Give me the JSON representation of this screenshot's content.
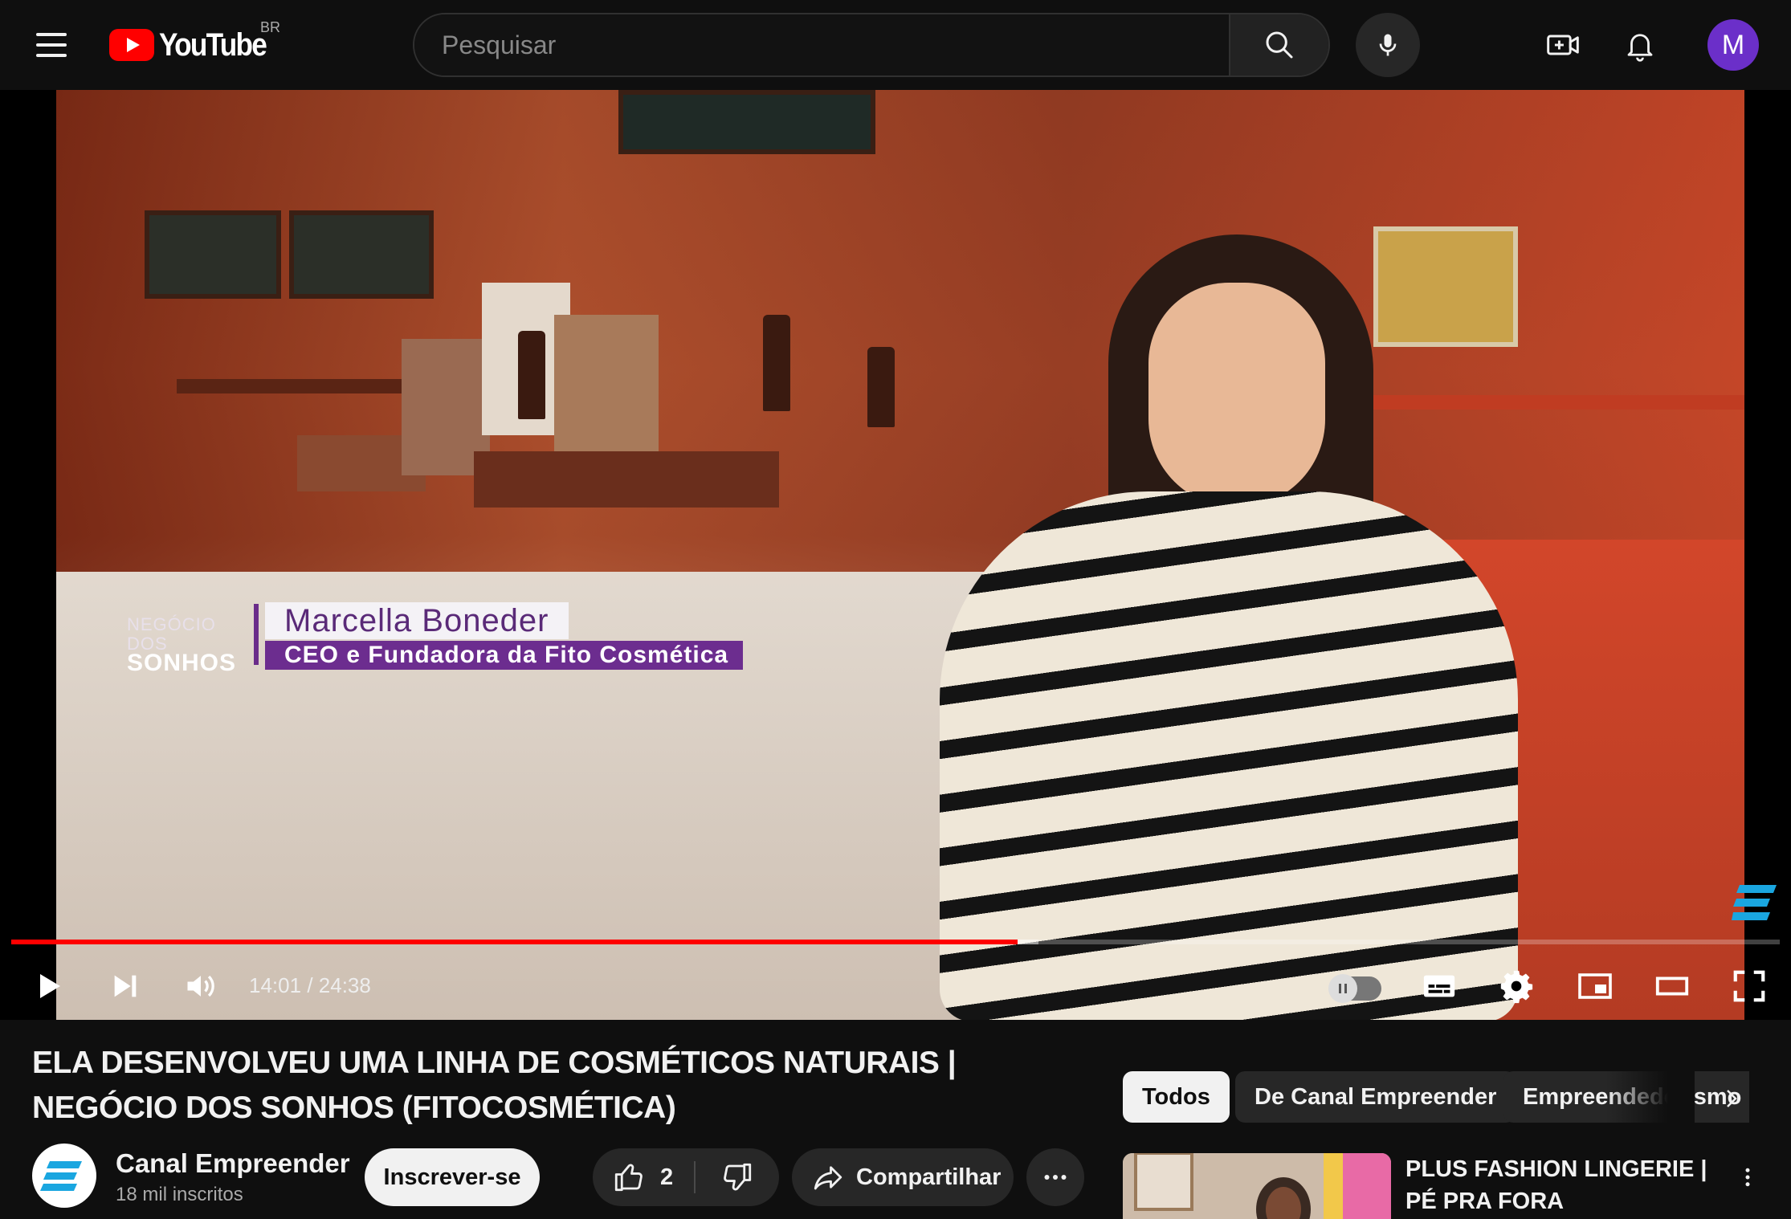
{
  "header": {
    "logo_text": "YouTube",
    "country": "BR",
    "search_placeholder": "Pesquisar",
    "avatar_letter": "M",
    "colors": {
      "brand": "#ff0000",
      "avatar": "#6b2fc9"
    }
  },
  "player": {
    "overlay": {
      "show_line1": "NEGÓCIO DOS",
      "show_line2": "SONHOS",
      "person_name": "Marcella Boneder",
      "person_role": "CEO e Fundadora da Fito Cosmética"
    },
    "current_time": "14:01",
    "duration": "24:38",
    "time_separator": "/",
    "progress_fraction": 0.569,
    "buffer_fraction": 0.581,
    "autoplay": "off",
    "icons": [
      "play-icon",
      "next-icon",
      "volume-icon",
      "autoplay-toggle",
      "subtitles-icon",
      "settings-icon",
      "miniplayer-icon",
      "theater-icon",
      "fullscreen-icon"
    ]
  },
  "video": {
    "title": "ELA DESENVOLVEU UMA LINHA DE COSMÉTICOS NATURAIS | NEGÓCIO DOS SONHOS (FITOCOSMÉTICA)",
    "channel_name": "Canal Empreender",
    "subscribers": "18 mil inscritos",
    "subscribe_label": "Inscrever-se",
    "like_count": "2",
    "share_label": "Compartilhar"
  },
  "chips": [
    {
      "label": "Todos",
      "active": true
    },
    {
      "label": "De Canal Empreender",
      "active": false
    },
    {
      "label": "Empreendedorismo",
      "active": false
    }
  ],
  "recommendation": {
    "title": "PLUS FASHION LINGERIE | PÉ PRA FORA"
  }
}
